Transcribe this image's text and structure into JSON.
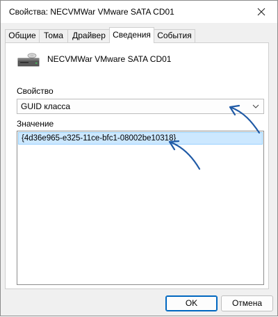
{
  "window": {
    "title": "Свойства: NECVMWar VMware SATA CD01"
  },
  "tabs": [
    {
      "label": "Общие"
    },
    {
      "label": "Тома"
    },
    {
      "label": "Драйвер"
    },
    {
      "label": "Сведения"
    },
    {
      "label": "События"
    }
  ],
  "active_tab": "Сведения",
  "device": {
    "name": "NECVMWar VMware SATA CD01",
    "icon": "optical-drive-icon"
  },
  "property": {
    "label": "Свойство",
    "selected": "GUID класса"
  },
  "value": {
    "label": "Значение",
    "items": [
      "{4d36e965-e325-11ce-bfc1-08002be10318}"
    ]
  },
  "buttons": {
    "ok": "OK",
    "cancel": "Отмена"
  },
  "colors": {
    "selection_bg": "#cce8ff",
    "selection_border": "#99d1ff",
    "accent": "#0067c0",
    "annotation_arrow": "#1f5aa6"
  }
}
